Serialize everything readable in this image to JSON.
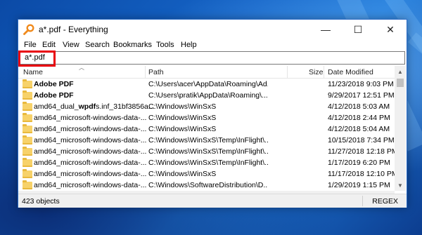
{
  "window": {
    "title": "a*.pdf - Everything",
    "minimize_glyph": "—",
    "maximize_glyph": "☐",
    "close_glyph": "✕"
  },
  "menu": [
    "File",
    "Edit",
    "View",
    "Search",
    "Bookmarks",
    "Tools",
    "Help"
  ],
  "search": {
    "value": "a*.pdf"
  },
  "columns": {
    "name": "Name",
    "path": "Path",
    "size": "Size",
    "date": "Date Modified"
  },
  "rows": [
    {
      "name_prefix": "Adobe PDF",
      "name_bold": "",
      "name_suffix": "",
      "path": "C:\\Users\\acer\\AppData\\Roaming\\Ad...",
      "date": "11/23/2018 9:03 PM"
    },
    {
      "name_prefix": "Adobe PDF",
      "name_bold": "",
      "name_suffix": "",
      "path": "C:\\Users\\pratik\\AppData\\Roaming\\...",
      "date": "9/29/2017 12:51 PM"
    },
    {
      "name_prefix": "amd64_dual_",
      "name_bold": "wpdf",
      "name_suffix": "s.inf_31bf3856a...",
      "path": "C:\\Windows\\WinSxS",
      "date": "4/12/2018 5:03 AM"
    },
    {
      "name_prefix": "amd64_microsoft-windows-data-...",
      "name_bold": "",
      "name_suffix": "",
      "path": "C:\\Windows\\WinSxS",
      "date": "4/12/2018 2:44 PM"
    },
    {
      "name_prefix": "amd64_microsoft-windows-data-...",
      "name_bold": "",
      "name_suffix": "",
      "path": "C:\\Windows\\WinSxS",
      "date": "4/12/2018 5:04 AM"
    },
    {
      "name_prefix": "amd64_microsoft-windows-data-...",
      "name_bold": "",
      "name_suffix": "",
      "path": "C:\\Windows\\WinSxS\\Temp\\InFlight\\...",
      "date": "10/15/2018 7:34 PM"
    },
    {
      "name_prefix": "amd64_microsoft-windows-data-...",
      "name_bold": "",
      "name_suffix": "",
      "path": "C:\\Windows\\WinSxS\\Temp\\InFlight\\...",
      "date": "11/27/2018 12:18 PM"
    },
    {
      "name_prefix": "amd64_microsoft-windows-data-...",
      "name_bold": "",
      "name_suffix": "",
      "path": "C:\\Windows\\WinSxS\\Temp\\InFlight\\...",
      "date": "1/17/2019 6:20 PM"
    },
    {
      "name_prefix": "amd64_microsoft-windows-data-...",
      "name_bold": "",
      "name_suffix": "",
      "path": "C:\\Windows\\WinSxS",
      "date": "11/17/2018 12:10 PM"
    },
    {
      "name_prefix": "amd64_microsoft-windows-data-...",
      "name_bold": "",
      "name_suffix": "",
      "path": "C:\\Windows\\SoftwareDistribution\\D...",
      "date": "1/29/2019 1:15 PM"
    }
  ],
  "status": {
    "count": "423 objects",
    "mode": "REGEX"
  },
  "colors": {
    "accent": "#2b6cc7",
    "highlight": "#e8000b",
    "folder": "#f7d26a"
  }
}
